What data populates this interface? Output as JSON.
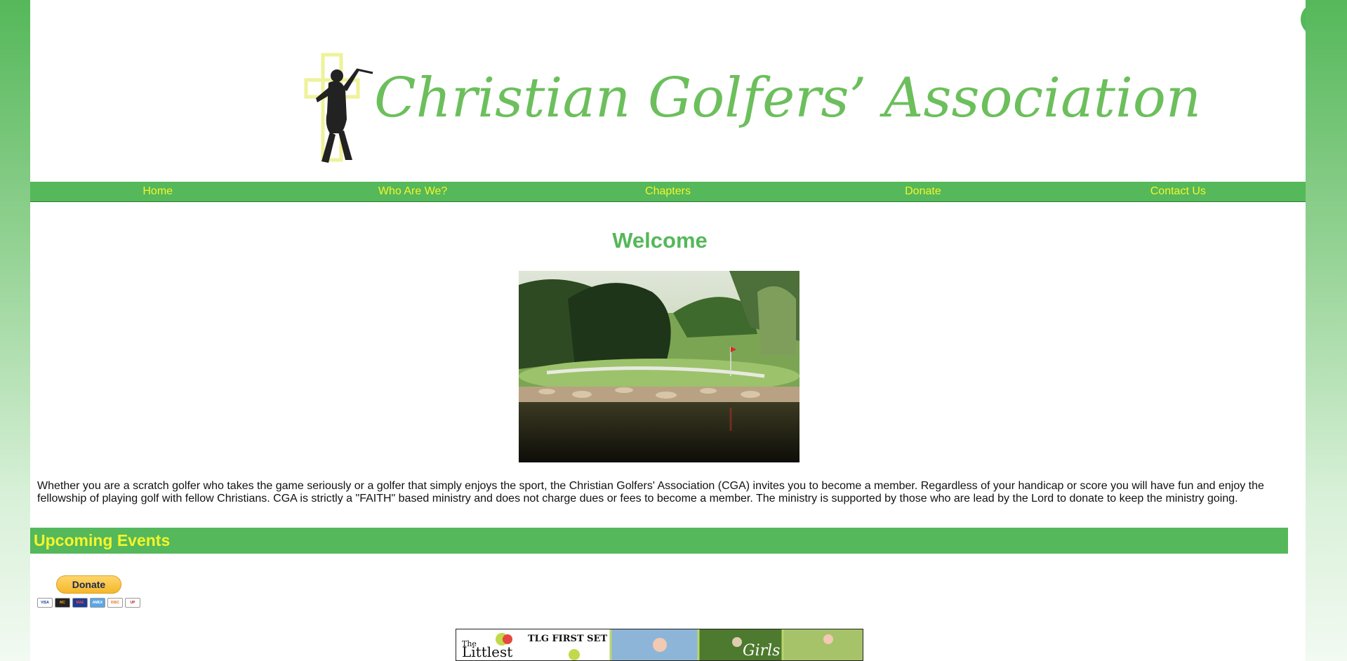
{
  "header": {
    "logo_text": "Christian Golfers’ Association"
  },
  "user_menu": {
    "icon": "user-icon"
  },
  "nav": {
    "items": [
      "Home",
      "Who Are We?",
      "Chapters",
      "Donate",
      "Contact Us"
    ]
  },
  "main": {
    "title": "Welcome",
    "intro": "Whether you are a scratch golfer who takes the game seriously or a golfer that simply enjoys the sport, the Christian Golfers' Association (CGA) invites you to become a member. Regardless of your handicap or score you will have fun and enjoy the fellowship of playing golf with fellow Christians. CGA is strictly a \"FAITH\" based ministry and does not charge dues or fees to become a member. The ministry is supported by those who are lead by the Lord to donate to keep the ministry going.",
    "events_heading": "Upcoming Events",
    "donate_label": "Donate",
    "cards": [
      "VISA",
      "MC",
      "MAE",
      "AMEX",
      "DISC",
      "UP"
    ]
  },
  "banner": {
    "brand_line1": "The",
    "brand_line2": "Littlest",
    "tlg_label": "TLG FIRST SET",
    "girls_label": "Girls"
  },
  "colors": {
    "brand_green": "#55b85a",
    "nav_text": "#f5f52a",
    "logo_green": "#6cbf5c",
    "cross_yellow": "#eef29a"
  }
}
